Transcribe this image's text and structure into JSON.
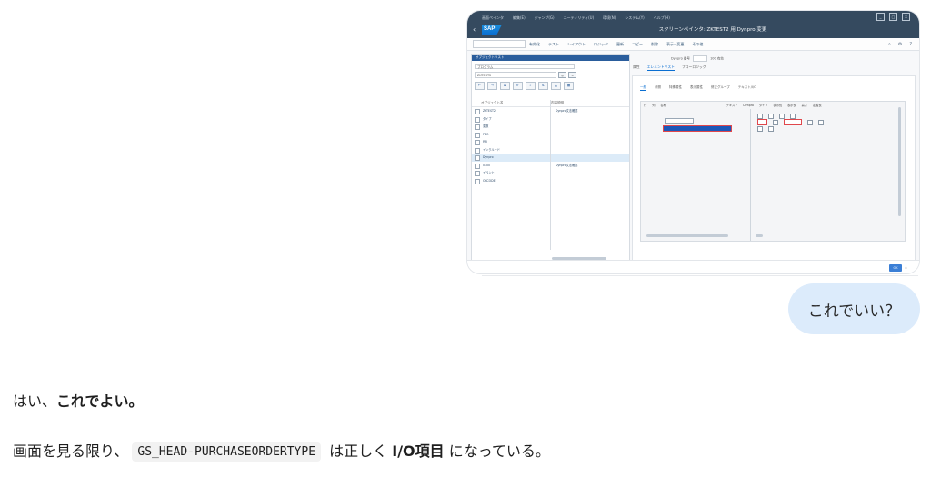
{
  "sap": {
    "menu": [
      "画面ペインタ",
      "編集(E)",
      "ジャンプ(G)",
      "ユーティリティ(U)",
      "環境(N)",
      "システム(Y)",
      "ヘルプ(H)"
    ],
    "window_buttons": [
      "_",
      "□",
      "×"
    ],
    "logo": "SAP",
    "title": "スクリーンペインタ: ZKTEST2 用 Dynpro 変更",
    "toolbar_items": [
      "有効化",
      "テスト",
      "レイアウト",
      "ロジック",
      "更新",
      "コピー",
      "削除",
      "表示→変更",
      "その他"
    ],
    "left_panel": {
      "header": "オブジェクトリスト",
      "select_value": "プログラム",
      "input_value": "ZKTEST2",
      "col_object": "オブジェクト名",
      "col_desc": "内容説明",
      "rows": [
        {
          "label": "ZKTEST2",
          "desc": "Dynpro文法確認"
        },
        {
          "label": "タイプ",
          "desc": ""
        },
        {
          "label": "変数",
          "desc": ""
        },
        {
          "label": "PBO",
          "desc": ""
        },
        {
          "label": "PAI",
          "desc": ""
        },
        {
          "label": "インクルード",
          "desc": ""
        },
        {
          "label": "Dynpro",
          "desc": ""
        },
        {
          "label": "0100",
          "desc": "Dynpro文法確認"
        },
        {
          "label": "イベント",
          "desc": ""
        },
        {
          "label": "OKCODE",
          "desc": ""
        }
      ]
    },
    "right_panel": {
      "dynpro_label": "Dynpro 番号",
      "dynpro_value": "100",
      "dynpro_status": "有効",
      "tabs": [
        "属性",
        "エレメントリスト",
        "フローロジック"
      ],
      "subtabs": [
        "一般",
        "参照",
        "特殊属性",
        "表示属性",
        "修正グループ",
        "テキスト/I/O"
      ],
      "table_headers": [
        "行",
        "列",
        "名称",
        "テキスト",
        "Dynpro",
        "タイプ",
        "表示長",
        "表示長",
        "高さ",
        "定義長"
      ]
    }
  },
  "chat": {
    "question": "これでいい？",
    "reply_prefix": "はい、",
    "reply_bold": "これでよい。",
    "line2_prefix": "画面を見る限り、",
    "line2_code": "GS_HEAD-PURCHASEORDERTYPE",
    "line2_mid": " は正しく ",
    "line2_bold": "I/O項目",
    "line2_suffix": " になっている。"
  },
  "colors": {
    "sap_header": "#354a5f",
    "selection_blue": "#1d57b8",
    "highlight_red": "#e0474c",
    "bubble": "#dcebfb"
  }
}
